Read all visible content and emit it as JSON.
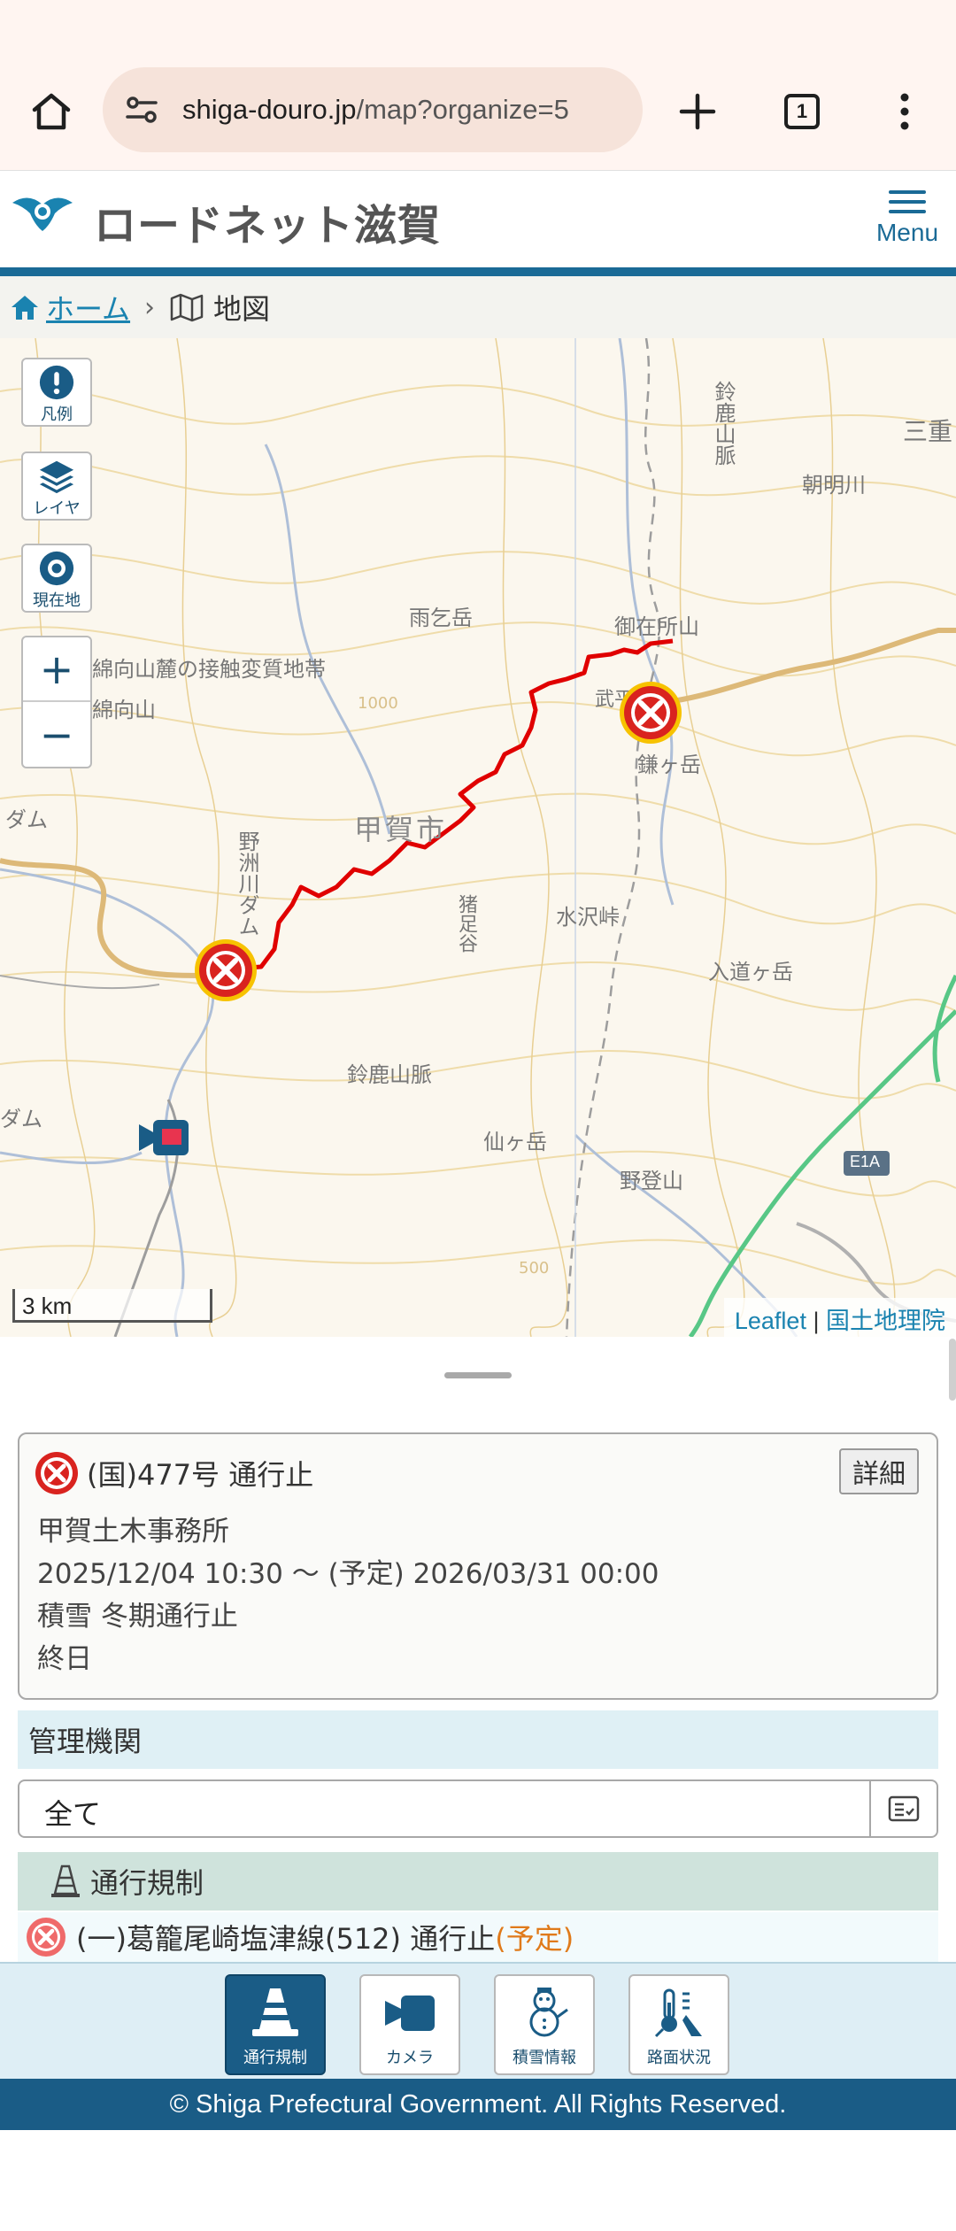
{
  "browser": {
    "url_domain": "shiga-douro.jp",
    "url_path": "/map?organize=5",
    "tab_count": "1"
  },
  "header": {
    "site_title": "ロードネット滋賀",
    "menu_label": "Menu"
  },
  "breadcrumb": {
    "home": "ホーム",
    "separator": "›",
    "current": "地図"
  },
  "map": {
    "controls": {
      "legend": "凡例",
      "layers": "レイヤ",
      "location": "現在地",
      "zoom_in": "+",
      "zoom_out": "−"
    },
    "scale": "3 km",
    "attribution": {
      "leaflet": "Leaflet",
      "separator": "|",
      "gsi": "国土地理院"
    },
    "labels": {
      "kouka": "甲賀市",
      "amagoi": "雨乞岳",
      "oshuzai": "御在所山",
      "suzuka_mtn": "鈴鹿山脈",
      "suzuka_mtn2": "鈴鹿山脈",
      "asahi": "朝明川",
      "mie": "三重",
      "watamuki": "綿向山",
      "watamuki_contact": "綿向山麓の接触変質地帯",
      "bugaoka": "武平峠",
      "kamagatake": "鎌ヶ岳",
      "mizusawa": "水沢峠",
      "nyudogatake": "入道ヶ岳",
      "inoashi": "猪足谷",
      "sengatake": "仙ヶ岳",
      "notozan": "野登山",
      "nosu": "野洲川ダム",
      "dam_left": "ダム",
      "dam_left2": "ダム",
      "e1a": "E1A",
      "c1000": "1000",
      "c500": "500"
    }
  },
  "incident": {
    "title": "(国)477号  通行止",
    "detail_button": "詳細",
    "office": "甲賀土木事務所",
    "period": "2025/12/04 10:30 〜 (予定) 2026/03/31 00:00",
    "reason": "積雪 冬期通行止",
    "time": "終日"
  },
  "filter": {
    "section_label": "管理機関",
    "select_value": "全て"
  },
  "regulation": {
    "section_label": "通行規制",
    "items": [
      {
        "text": "(一)葛籠尾崎塩津線(512)  通行止",
        "tag": "(予定)"
      }
    ]
  },
  "bottom_nav": {
    "items": [
      {
        "label": "通行規制"
      },
      {
        "label": "カメラ"
      },
      {
        "label": "積雪情報"
      },
      {
        "label": "路面状況"
      }
    ]
  },
  "footer": {
    "copyright": "© Shiga Prefectural Government. All Rights Reserved."
  },
  "colors": {
    "brand": "#1a5c86",
    "link": "#1a83b0",
    "closure_red": "#d9231f",
    "closure_ring": "#f7c200",
    "route_line": "#e00000",
    "warning_orange": "#e07a1a"
  },
  "icons": [
    "home-icon",
    "tune-icon",
    "plus-icon",
    "tabs-icon",
    "more-vert-icon",
    "site-logo-icon",
    "menu-icon",
    "map-icon",
    "info-icon",
    "layers-icon",
    "target-icon",
    "closure-icon",
    "camera-icon",
    "checklist-icon",
    "traffic-cone-icon",
    "snowman-icon",
    "road-thermo-icon"
  ]
}
